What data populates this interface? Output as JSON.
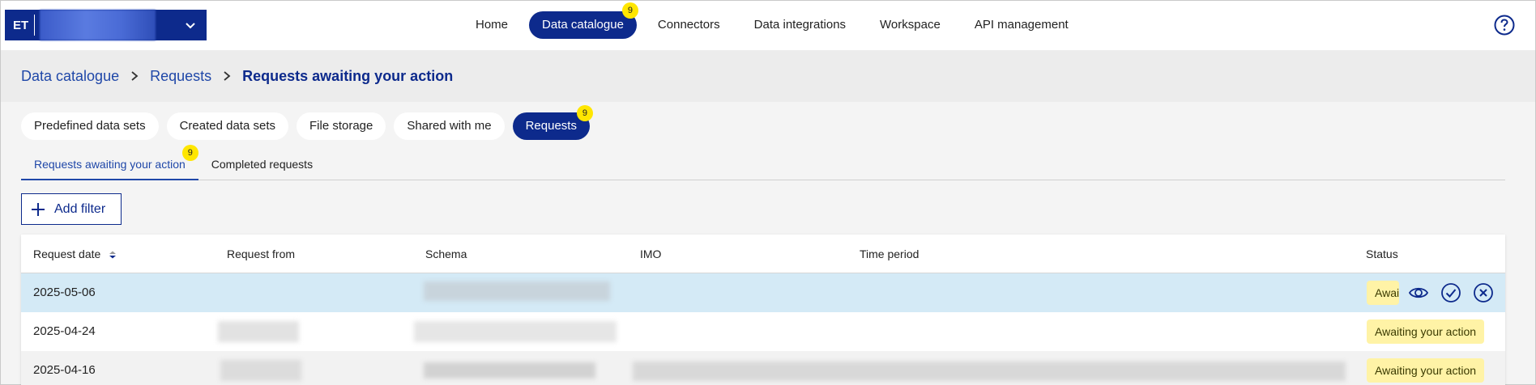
{
  "header": {
    "org_code": "ET",
    "nav": [
      {
        "label": "Home"
      },
      {
        "label": "Data catalogue",
        "badge": "9"
      },
      {
        "label": "Connectors"
      },
      {
        "label": "Data integrations"
      },
      {
        "label": "Workspace"
      },
      {
        "label": "API management"
      }
    ]
  },
  "breadcrumb": {
    "items": [
      "Data catalogue",
      "Requests"
    ],
    "current": "Requests awaiting your action"
  },
  "tabs": [
    {
      "label": "Predefined data sets"
    },
    {
      "label": "Created data sets"
    },
    {
      "label": "File storage"
    },
    {
      "label": "Shared with me"
    },
    {
      "label": "Requests",
      "badge": "9"
    }
  ],
  "subtabs": [
    {
      "label": "Requests awaiting your action",
      "badge": "9"
    },
    {
      "label": "Completed requests"
    }
  ],
  "filter": {
    "add_label": "Add filter"
  },
  "table": {
    "columns": [
      "Request date",
      "Request from",
      "Schema",
      "IMO",
      "Time period",
      "Status"
    ],
    "rows": [
      {
        "date": "2025-05-06",
        "status": "Awaiting your action"
      },
      {
        "date": "2025-04-24",
        "status": "Awaiting your action"
      },
      {
        "date": "2025-04-16",
        "status": "Awaiting your action"
      }
    ]
  },
  "colors": {
    "brand": "#0d2a8c",
    "link": "#1f47a8",
    "badge": "#ffe600",
    "status_bg": "#fff3a6",
    "row_selected": "#d4eaf6"
  }
}
